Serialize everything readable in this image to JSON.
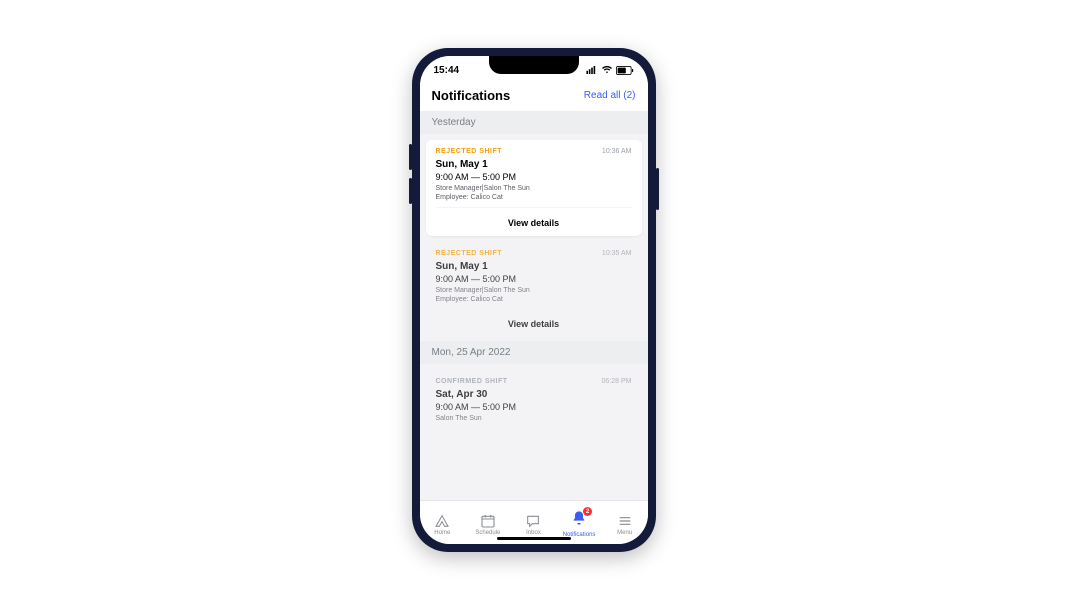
{
  "status": {
    "time": "15:44"
  },
  "header": {
    "title": "Notifications",
    "readall": "Read all (2)"
  },
  "sections": {
    "s1": {
      "label": "Yesterday"
    },
    "s2": {
      "label": "Mon, 25 Apr 2022"
    }
  },
  "cards": {
    "c1": {
      "tag": "REJECTED SHIFT",
      "time": "10:36 AM",
      "date": "Sun, May  1",
      "hours": "9:00 AM —  5:00 PM",
      "role": "Store Manager|Salon The Sun",
      "employee": "Employee: Calico Cat",
      "view": "View details"
    },
    "c2": {
      "tag": "REJECTED SHIFT",
      "time": "10:35 AM",
      "date": "Sun, May  1",
      "hours": "9:00 AM —  5:00 PM",
      "role": "Store Manager|Salon The Sun",
      "employee": "Employee: Calico Cat",
      "view": "View details"
    },
    "c3": {
      "tag": "CONFIRMED SHIFT",
      "time": "06:28 PM",
      "date": "Sat, Apr 30",
      "hours": "9:00 AM —  5:00 PM",
      "role": "Salon The Sun"
    }
  },
  "tabs": {
    "home": "Home",
    "schedule": "Schedule",
    "inbox": "Inbox",
    "notifications": "Notifications",
    "menu": "Menu",
    "badge": "2"
  }
}
